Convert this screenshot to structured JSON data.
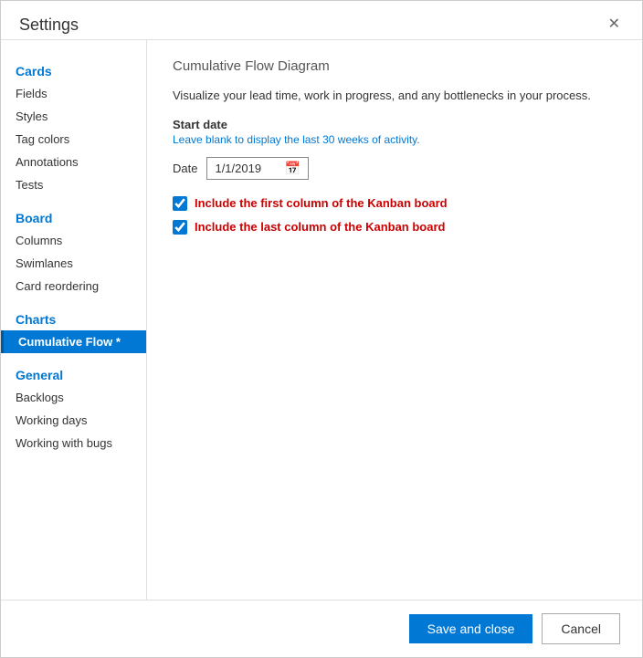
{
  "dialog": {
    "title": "Settings",
    "close_label": "✕"
  },
  "sidebar": {
    "sections": [
      {
        "label": "Cards",
        "items": [
          {
            "id": "fields",
            "label": "Fields",
            "active": false
          },
          {
            "id": "styles",
            "label": "Styles",
            "active": false
          },
          {
            "id": "tag-colors",
            "label": "Tag colors",
            "active": false
          },
          {
            "id": "annotations",
            "label": "Annotations",
            "active": false
          },
          {
            "id": "tests",
            "label": "Tests",
            "active": false
          }
        ]
      },
      {
        "label": "Board",
        "items": [
          {
            "id": "columns",
            "label": "Columns",
            "active": false
          },
          {
            "id": "swimlanes",
            "label": "Swimlanes",
            "active": false
          },
          {
            "id": "card-reordering",
            "label": "Card reordering",
            "active": false
          }
        ]
      },
      {
        "label": "Charts",
        "items": [
          {
            "id": "cumulative-flow",
            "label": "Cumulative Flow *",
            "active": true
          }
        ]
      },
      {
        "label": "General",
        "items": [
          {
            "id": "backlogs",
            "label": "Backlogs",
            "active": false
          },
          {
            "id": "working-days",
            "label": "Working days",
            "active": false
          },
          {
            "id": "working-with-bugs",
            "label": "Working with bugs",
            "active": false
          }
        ]
      }
    ]
  },
  "content": {
    "title": "Cumulative Flow Diagram",
    "description_part1": "Visualize your lead time, work in progress, and any bottlenecks in your process.",
    "start_date_label": "Start date",
    "start_date_hint": "Leave blank to display the last 30 weeks of activity.",
    "date_field_label": "Date",
    "date_value": "1/1/2019",
    "checkbox1_label": "Include the first column of the Kanban board",
    "checkbox1_checked": true,
    "checkbox2_label": "Include the last column of the Kanban board",
    "checkbox2_checked": true
  },
  "footer": {
    "save_label": "Save and close",
    "cancel_label": "Cancel"
  }
}
